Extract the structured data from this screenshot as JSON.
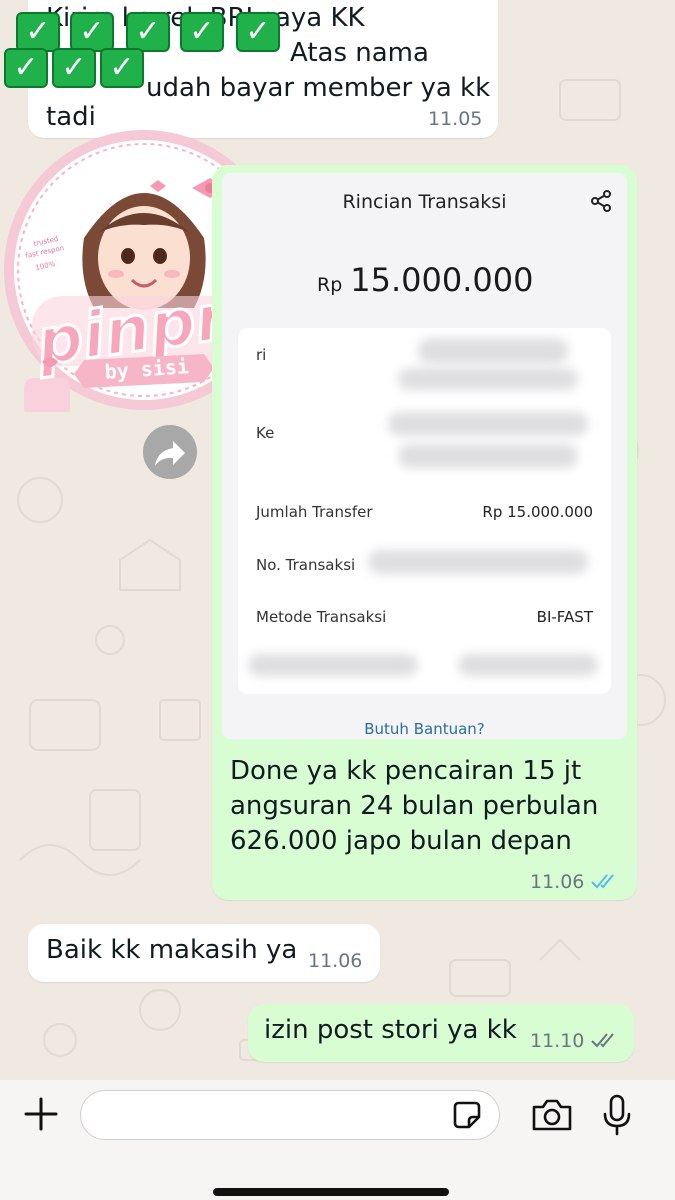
{
  "chat": {
    "top_message": {
      "line1": "Kirim ke rek BRI saya KK",
      "line2": "Atas nama",
      "line3": "udah bayar member ya kk",
      "line4": "tadi",
      "time": "11.05"
    },
    "sticker": {
      "brand": "pinpri",
      "tagline": "by sisi",
      "badge_line1": "trusted",
      "badge_line2": "fast respon",
      "badge_line3": "100%"
    },
    "transaction_receipt": {
      "title": "Rincian Transaksi",
      "currency": "Rp",
      "amount": "15.000.000",
      "from_label": "ri",
      "to_label": "Ke",
      "transfer_label": "Jumlah Transfer",
      "transfer_value": "Rp 15.000.000",
      "txn_no_label": "No. Transaksi",
      "method_label": "Metode Transaksi",
      "method_value": "BI-FAST",
      "help_link": "Butuh Bantuan?"
    },
    "trx_caption": {
      "line1": "Done ya kk pencairan 15 jt",
      "line2": "angsuran 24 bulan perbulan",
      "line3": "626.000 japo bulan depan",
      "time": "11.06",
      "status": "read"
    },
    "incoming_reply": {
      "text": "Baik kk makasih ya",
      "time": "11.06"
    },
    "outgoing_last": {
      "text": "izin post stori ya kk",
      "time": "11.10",
      "status": "delivered"
    }
  },
  "input_bar": {
    "placeholder": ""
  },
  "colors": {
    "outgoing_bubble": "#d9fdd3",
    "incoming_bubble": "#ffffff",
    "read_ticks": "#53bdeb",
    "delivered_ticks": "#667781",
    "wallpaper": "#efe9e1"
  }
}
